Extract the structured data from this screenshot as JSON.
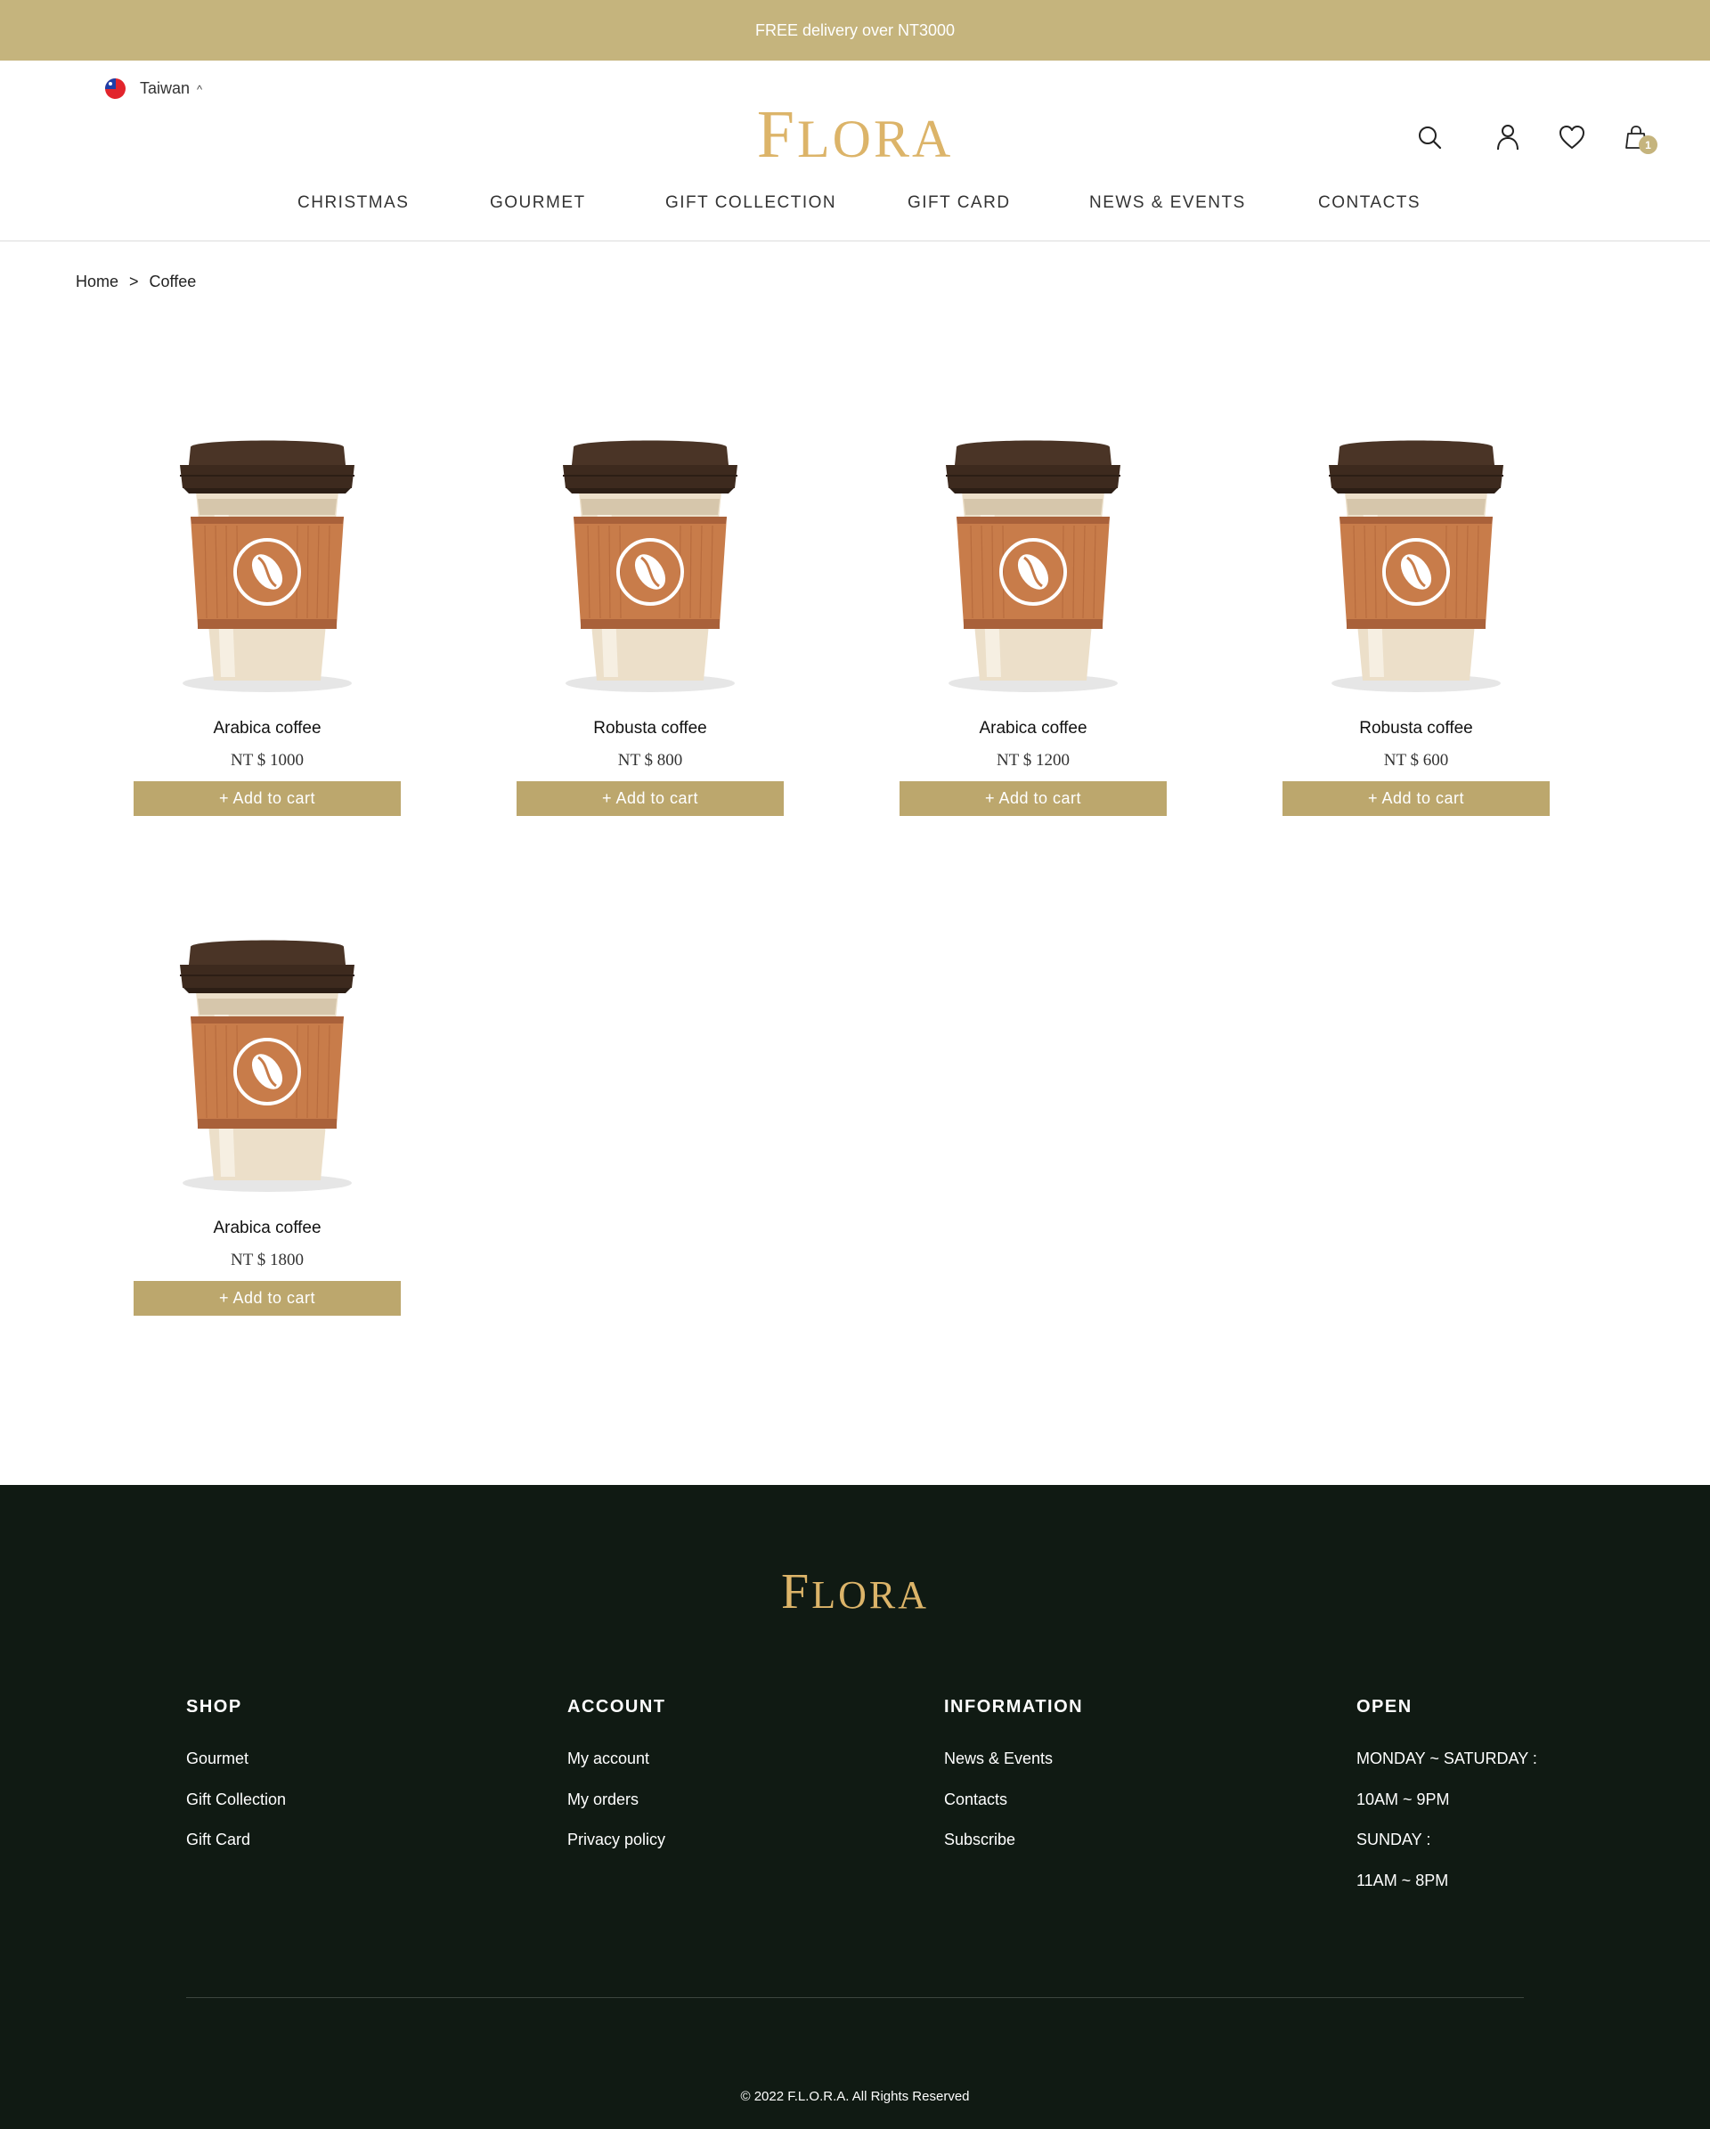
{
  "topbar": {
    "text": "FREE delivery over NT3000"
  },
  "header": {
    "region": "Taiwan",
    "region_caret": "^",
    "logo": {
      "first": "F",
      "rest": "LORA"
    },
    "cart_count": "1",
    "icons": [
      "search-icon",
      "user-icon",
      "heart-icon",
      "shopping-bag-icon"
    ]
  },
  "nav": {
    "items": [
      "CHRISTMAS",
      "GOURMET",
      "GIFT COLLECTION",
      "GIFT CARD",
      "NEWS & EVENTS",
      "CONTACTS"
    ]
  },
  "breadcrumb": {
    "home": "Home",
    "separator": ">",
    "current": "Coffee"
  },
  "products": [
    {
      "name": "Arabica coffee",
      "price": "NT $ 1000",
      "button": "+ Add to cart"
    },
    {
      "name": "Robusta coffee",
      "price": "NT $ 800",
      "button": "+ Add to cart"
    },
    {
      "name": "Arabica coffee",
      "price": "NT $ 1200",
      "button": "+ Add to cart"
    },
    {
      "name": "Robusta coffee",
      "price": "NT $ 600",
      "button": "+ Add to cart"
    },
    {
      "name": "Arabica coffee",
      "price": "NT $ 1800",
      "button": "+ Add to cart"
    }
  ],
  "footer": {
    "logo": {
      "first": "F",
      "rest": "LORA"
    },
    "shop": {
      "title": "SHOP",
      "links": [
        "Gourmet",
        "Gift Collection",
        "Gift Card"
      ]
    },
    "account": {
      "title": "ACCOUNT",
      "links": [
        "My account",
        "My orders",
        "Privacy policy"
      ]
    },
    "information": {
      "title": "INFORMATION",
      "links": [
        "News & Events",
        "Contacts",
        "Subscribe"
      ]
    },
    "open": {
      "title": "OPEN",
      "lines": [
        "MONDAY ~ SATURDAY :",
        "10AM ~ 9PM",
        "SUNDAY :",
        "11AM ~ 8PM"
      ]
    },
    "copyright": "© 2022 F.L.O.R.A. All Rights Reserved"
  },
  "colors": {
    "gold": "#c5b47d",
    "button": "#bca76d",
    "logo": "#dcb469",
    "footer_bg": "#101a13",
    "cup_lid": "#3d2a1e",
    "cup_sleeve": "#c87c4a",
    "cup_body": "#ecdfc9"
  }
}
